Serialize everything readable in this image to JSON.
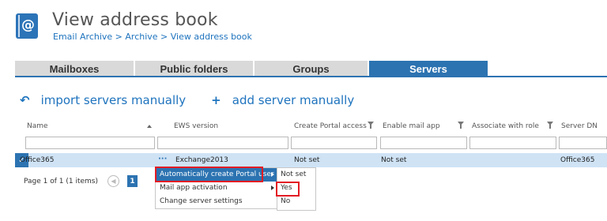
{
  "header": {
    "icon": "address-book-icon",
    "title": "View address book",
    "breadcrumb": "Email Archive > Archive > View address book"
  },
  "tabs": [
    {
      "label": "Mailboxes",
      "active": false
    },
    {
      "label": "Public folders",
      "active": false
    },
    {
      "label": "Groups",
      "active": false
    },
    {
      "label": "Servers",
      "active": true
    }
  ],
  "actions": {
    "import": {
      "icon": "undo-arrow-icon",
      "label": "import servers manually"
    },
    "add": {
      "icon": "plus-icon",
      "label": "add server manually"
    }
  },
  "columns": {
    "name": "Name",
    "ews_version": "EWS version",
    "create_portal_access": "Create Portal access",
    "enable_mail_app": "Enable mail app",
    "associate_with_role": "Associate with role",
    "server_dn": "Server DN"
  },
  "row": {
    "name": "Office365",
    "ews_version": "Exchange2013",
    "create_portal_access": "Not set",
    "enable_mail_app": "Not set",
    "server_dn": "Office365"
  },
  "pager": {
    "summary": "Page 1 of 1 (1 items)",
    "current_page": "1"
  },
  "context_menu": {
    "items": [
      {
        "label": "Automatically create Portal user",
        "has_submenu": true
      },
      {
        "label": "Mail app activation",
        "has_submenu": true
      },
      {
        "label": "Change server settings",
        "has_submenu": false
      }
    ]
  },
  "submenu": {
    "items": [
      "Not set",
      "Yes",
      "No"
    ]
  },
  "colors": {
    "accent": "#2c73b1",
    "highlight": "#e31b23",
    "tab_inactive": "#d9d9d9",
    "selected_row": "#cfe3f5"
  }
}
